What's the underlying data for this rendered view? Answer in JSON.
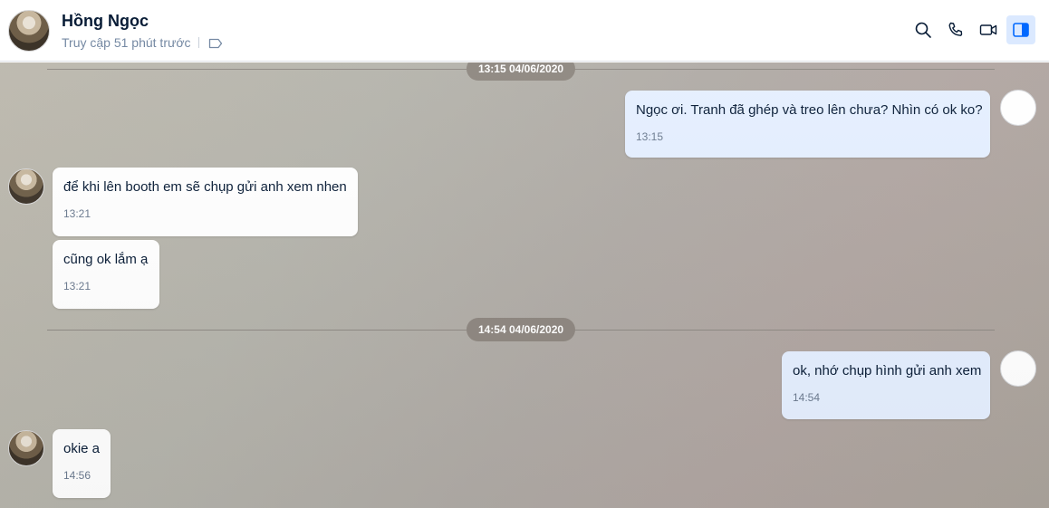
{
  "header": {
    "contact_name": "Hồng Ngọc",
    "last_seen": "Truy cập 51 phút trước",
    "actions": [
      "search-icon",
      "phone-icon",
      "video-icon",
      "sidebar-toggle-icon"
    ]
  },
  "colors": {
    "accent": "#0068ff",
    "outgoing_bubble": "#e5efff",
    "incoming_bubble": "#ffffff",
    "separator_pill": "#8e8780"
  },
  "separators": [
    {
      "label": "13:15 04/06/2020"
    },
    {
      "label": "14:54 04/06/2020"
    }
  ],
  "messages": [
    {
      "direction": "out",
      "text": "Ngọc ơi. Tranh đã ghép và treo lên chưa? Nhìn có ok ko?",
      "time": "13:15"
    },
    {
      "direction": "in",
      "text": "để khi lên booth em sẽ chụp gửi anh xem nhen",
      "time": "13:21"
    },
    {
      "direction": "in",
      "text": "cũng ok lắm ạ",
      "time": "13:21"
    },
    {
      "direction": "out",
      "text": "ok, nhớ chụp hình gửi anh xem",
      "time": "14:54"
    },
    {
      "direction": "in",
      "text": "okie a",
      "time": "14:56"
    }
  ]
}
